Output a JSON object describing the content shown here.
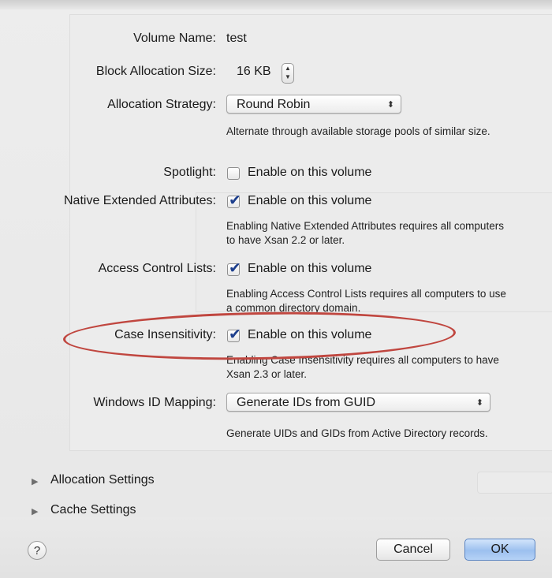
{
  "dialog": {
    "volume_name_label": "Volume Name:",
    "volume_name_value": "test",
    "block_allocation_label": "Block Allocation Size:",
    "block_allocation_value": "16 KB",
    "allocation_strategy_label": "Allocation Strategy:",
    "allocation_strategy_value": "Round Robin",
    "allocation_strategy_note": "Alternate through available storage pools of similar size.",
    "spotlight_label": "Spotlight:",
    "spotlight_checkbox_label": "Enable on this volume",
    "spotlight_checked": false,
    "nea_label": "Native Extended Attributes:",
    "nea_checkbox_label": "Enable on this volume",
    "nea_checked": true,
    "nea_note": "Enabling Native Extended Attributes requires all computers to have Xsan 2.2 or later.",
    "acl_label": "Access Control Lists:",
    "acl_checkbox_label": "Enable on this volume",
    "acl_checked": true,
    "acl_note": "Enabling Access Control Lists requires all computers to use a common directory domain.",
    "case_label": "Case Insensitivity:",
    "case_checkbox_label": "Enable on this volume",
    "case_checked": true,
    "case_note": "Enabling Case Insensitivity requires all computers to have Xsan 2.3 or later.",
    "windows_id_label": "Windows ID Mapping:",
    "windows_id_value": "Generate IDs from GUID",
    "windows_id_note": "Generate UIDs and GIDs from Active Directory records.",
    "allocation_settings_label": "Allocation Settings",
    "cache_settings_label": "Cache Settings",
    "help_label": "?",
    "cancel_label": "Cancel",
    "ok_label": "OK"
  },
  "colors": {
    "annotation": "#c0463f",
    "checkmark": "#1d3f8d",
    "ok_button": "#9cc0ef"
  },
  "icons": {
    "stepper": "stepper-icon",
    "popup_arrows": "updown-arrows-icon",
    "disclosure": "disclosure-triangle-icon",
    "help": "help-icon"
  }
}
